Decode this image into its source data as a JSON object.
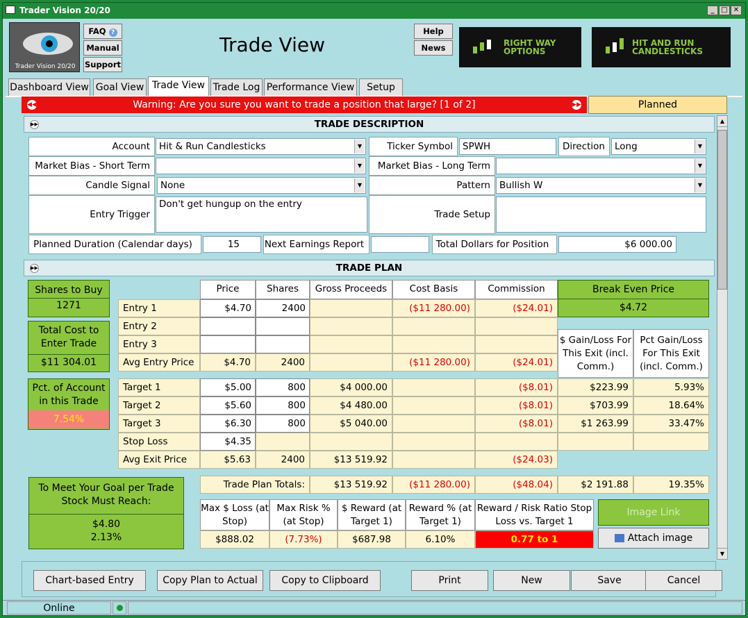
{
  "window": {
    "title": "Trader Vision 20/20"
  },
  "header": {
    "logo_text": "Trader Vision 20/20",
    "faq": "FAQ",
    "manual": "Manual",
    "support": "Support",
    "page_title": "Trade View",
    "help": "Help",
    "news": "News",
    "banner1": "RIGHT WAY OPTIONS",
    "banner2": "HIT AND RUN CANDLESTICKS"
  },
  "tabs": [
    "Dashboard View",
    "Goal View",
    "Trade View",
    "Trade Log",
    "Performance View",
    "Setup"
  ],
  "warning": {
    "text": "Warning: Are you sure you want to trade a position that large? [1 of 2]",
    "status": "Planned"
  },
  "desc": {
    "section": "TRADE DESCRIPTION",
    "account_label": "Account",
    "account": "Hit & Run Candlesticks",
    "ticker_label": "Ticker Symbol",
    "ticker": "SPWH",
    "direction_label": "Direction",
    "direction": "Long",
    "bias_short_label": "Market Bias - Short Term",
    "bias_short": "",
    "bias_long_label": "Market Bias - Long Term",
    "bias_long": "",
    "candle_label": "Candle Signal",
    "candle": "None",
    "pattern_label": "Pattern",
    "pattern": "Bullish W",
    "entry_trigger_label": "Entry Trigger",
    "entry_trigger": "Don't get hungup on the entry",
    "setup_label": "Trade Setup",
    "setup": "",
    "duration_label": "Planned Duration (Calendar days)",
    "duration": "15",
    "earnings_label": "Next Earnings Report",
    "earnings": "",
    "total_label": "Total Dollars for Position",
    "total": "$6 000.00"
  },
  "plan": {
    "section": "TRADE PLAN",
    "shares_to_buy_label": "Shares to Buy",
    "shares_to_buy": "1271",
    "total_cost_label": "Total Cost to Enter Trade",
    "total_cost": "$11 304.01",
    "pct_account_label": "Pct. of Account in this Trade",
    "pct_account": "7.54%",
    "goal_label": "To Meet Your Goal per Trade Stock Must Reach:",
    "goal_price": "$4.80",
    "goal_pct": "2.13%",
    "cols": [
      "Price",
      "Shares",
      "Gross Proceeds",
      "Cost Basis",
      "Commission"
    ],
    "break_even_label": "Break Even Price",
    "break_even": "$4.72",
    "gain_label": "$ Gain/Loss For This Exit (incl. Comm.)",
    "pct_gain_label": "Pct Gain/Loss For This Exit (incl. Comm.)",
    "rows": {
      "entry1": {
        "label": "Entry 1",
        "price": "$4.70",
        "shares": "2400",
        "cost": "($11 280.00)",
        "comm": "($24.01)"
      },
      "entry2": {
        "label": "Entry 2"
      },
      "entry3": {
        "label": "Entry 3"
      },
      "avg_entry": {
        "label": "Avg Entry Price",
        "price": "$4.70",
        "shares": "2400",
        "cost": "($11 280.00)",
        "comm": "($24.01)"
      },
      "t1": {
        "label": "Target 1",
        "price": "$5.00",
        "shares": "800",
        "gross": "$4 000.00",
        "comm": "($8.01)",
        "gain": "$223.99",
        "pct": "5.93%"
      },
      "t2": {
        "label": "Target 2",
        "price": "$5.60",
        "shares": "800",
        "gross": "$4 480.00",
        "comm": "($8.01)",
        "gain": "$703.99",
        "pct": "18.64%"
      },
      "t3": {
        "label": "Target 3",
        "price": "$6.30",
        "shares": "800",
        "gross": "$5 040.00",
        "comm": "($8.01)",
        "gain": "$1 263.99",
        "pct": "33.47%"
      },
      "stop": {
        "label": "Stop Loss",
        "price": "$4.35"
      },
      "avg_exit": {
        "label": "Avg Exit Price",
        "price": "$5.63",
        "shares": "2400",
        "gross": "$13 519.92",
        "comm": "($24.03)"
      }
    },
    "totals": {
      "label": "Trade Plan Totals:",
      "gross": "$13 519.92",
      "cost": "($11 280.00)",
      "comm": "($48.04)",
      "gain": "$2 191.88",
      "pct": "19.35%"
    },
    "risk": {
      "h1": "Max $ Loss (at Stop)",
      "v1": "$888.02",
      "h2": "Max Risk % (at Stop)",
      "v2": "(7.73%)",
      "h3": "$ Reward (at Target 1)",
      "v3": "$687.98",
      "h4": "Reward % (at Target 1)",
      "v4": "6.10%",
      "h5": "Reward / Risk Ratio Stop Loss vs. Target 1",
      "v5": "0.77 to 1"
    },
    "image_link": "Image Link",
    "attach_image": "Attach image"
  },
  "buttons": {
    "chart_entry": "Chart-based Entry",
    "copy_actual": "Copy Plan to Actual",
    "copy_clip": "Copy to Clipboard",
    "print": "Print",
    "new": "New",
    "save": "Save",
    "cancel": "Cancel"
  },
  "status": {
    "online": "Online"
  }
}
